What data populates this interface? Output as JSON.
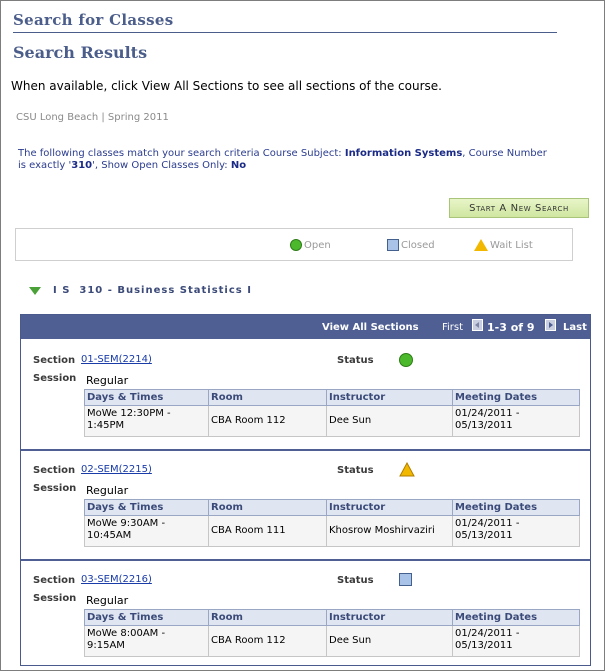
{
  "page": {
    "title": "Search for Classes",
    "subtitle": "Search Results",
    "instructions": "When available, click View All Sections to see all sections of the course.",
    "institution": "CSU Long Beach | Spring 2011",
    "criteria_prefix": "The following classes match your search criteria Course Subject:",
    "criteria_subject": "Information Systems",
    "criteria_mid": ",  Course Number is exactly '",
    "criteria_number": "310",
    "criteria_open": "',  Show Open Classes Only:",
    "criteria_open_val": "No",
    "new_search_label": "Start A New Search"
  },
  "legend": {
    "open": "Open",
    "closed": "Closed",
    "wait": "Wait List"
  },
  "course": {
    "header": "I S  310 - Business Statistics I"
  },
  "grid": {
    "view_all": "View All Sections",
    "first": "First",
    "range": "1-3 of 9",
    "last": "Last"
  },
  "labels": {
    "section": "Section",
    "session": "Session",
    "status": "Status",
    "col_days": "Days & Times",
    "col_room": "Room",
    "col_instructor": "Instructor",
    "col_dates": "Meeting Dates"
  },
  "sections": [
    {
      "link": "01-SEM(2214)",
      "status": "open",
      "session": "Regular",
      "days_line1": "MoWe 12:30PM -",
      "days_line2": "1:45PM",
      "room": "CBA  Room 112",
      "instructor": "Dee Sun",
      "dates_line1": "01/24/2011 -",
      "dates_line2": "05/13/2011"
    },
    {
      "link": "02-SEM(2215)",
      "status": "wait",
      "session": "Regular",
      "days_line1": "MoWe 9:30AM -",
      "days_line2": "10:45AM",
      "room": "CBA  Room 111",
      "instructor": "Khosrow Moshirvaziri",
      "dates_line1": "01/24/2011 -",
      "dates_line2": "05/13/2011"
    },
    {
      "link": "03-SEM(2216)",
      "status": "closed",
      "session": "Regular",
      "days_line1": "MoWe 8:00AM -",
      "days_line2": "9:15AM",
      "room": "CBA  Room 112",
      "instructor": "Dee Sun",
      "dates_line1": "01/24/2011 -",
      "dates_line2": "05/13/2011"
    }
  ],
  "colors": {
    "header_blue": "#4b5d8a",
    "grid_bar": "#4f5e93",
    "open_green": "#4cb82c",
    "wait_yellow": "#f2b800",
    "closed_blue": "#a8c2e8"
  }
}
